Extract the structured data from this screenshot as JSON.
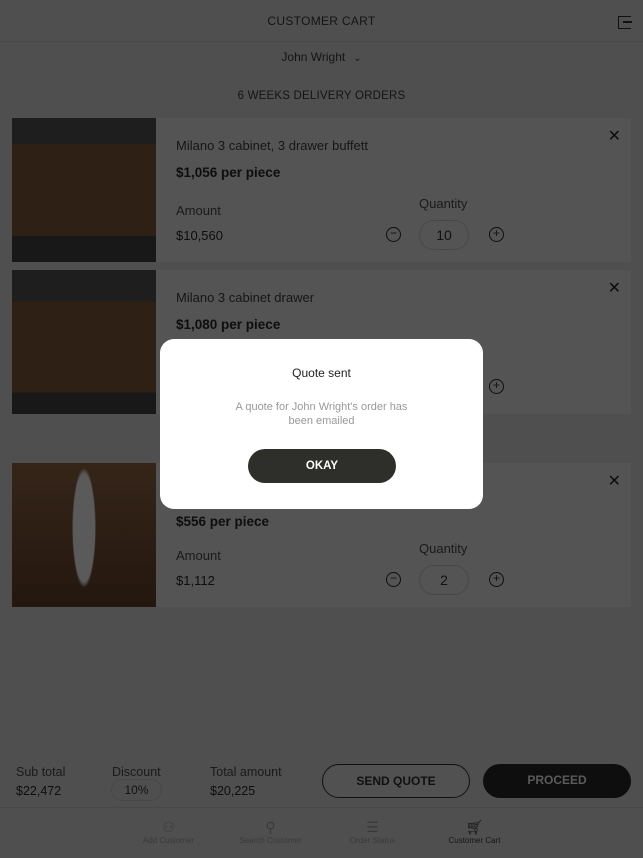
{
  "header": {
    "title": "CUSTOMER CART",
    "logout_icon": "logout-icon"
  },
  "customer": {
    "name": "John Wright"
  },
  "section_title": "6 WEEKS DELIVERY ORDERS",
  "items": [
    {
      "name": "Milano 3 cabinet, 3 drawer buffett",
      "price": "$1,056 per piece",
      "amount_label": "Amount",
      "amount": "$10,560",
      "quantity_label": "Quantity",
      "quantity": "10"
    },
    {
      "name": "Milano 3 cabinet drawer",
      "price": "$1,080 per piece"
    },
    {
      "price": "$556 per piece",
      "amount_label": "Amount",
      "amount": "$1,112",
      "quantity_label": "Quantity",
      "quantity": "2"
    }
  ],
  "summary": {
    "subtotal_label": "Sub total",
    "subtotal": "$22,472",
    "discount_label": "Discount",
    "discount": "10%",
    "total_label": "Total amount",
    "total": "$20,225",
    "send_quote": "SEND QUOTE",
    "proceed": "PROCEED"
  },
  "nav": [
    {
      "label": "Add Customer"
    },
    {
      "label": "Search Customer"
    },
    {
      "label": "Order Status"
    },
    {
      "label": "Customer Cart",
      "active": true
    }
  ],
  "modal": {
    "title": "Quote sent",
    "message": "A quote for John Wright's order has been emailed",
    "ok": "OKAY"
  }
}
